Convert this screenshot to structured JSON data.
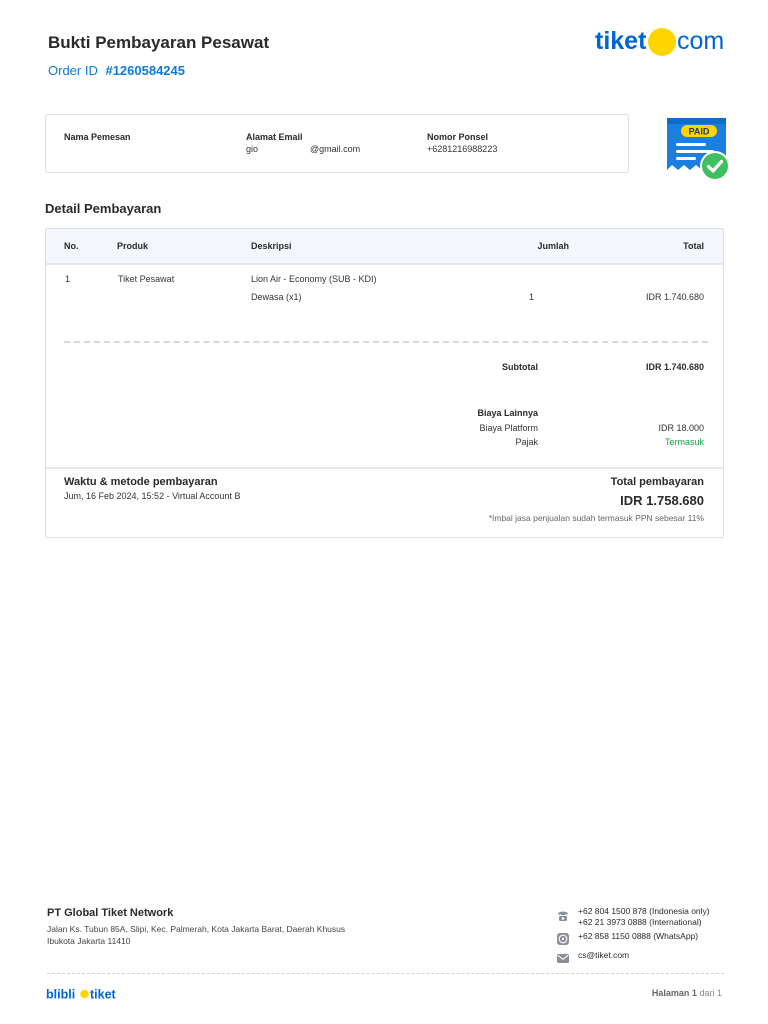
{
  "header": {
    "title": "Bukti Pembayaran Pesawat",
    "order_label": "Order ID",
    "order_id": "#1260584245",
    "logo_text": "tiket",
    "logo_suffix": "com",
    "logo_dot_color": "#FFD500",
    "brand_color": "#0064D2"
  },
  "customer": {
    "name_label": "Nama Pemesan",
    "name_value": "",
    "email_label": "Alamat Email",
    "email_user": "gio",
    "email_domain": "@gmail.com",
    "phone_label": "Nomor Ponsel",
    "phone_value": "+6281216988223"
  },
  "badge": {
    "text": "PAID",
    "icon": "paid-receipt-check-icon"
  },
  "details": {
    "title": "Detail Pembayaran",
    "columns": [
      "No.",
      "Produk",
      "Deskripsi",
      "Jumlah",
      "Total"
    ],
    "rows": [
      {
        "no": "1",
        "product": "Tiket Pesawat",
        "description": "Lion Air - Economy (SUB - KDI)",
        "sub_description": "Dewasa (x1)",
        "qty": "1",
        "total": "IDR 1.740.680"
      }
    ],
    "subtotal_label": "Subtotal",
    "subtotal_value": "IDR 1.740.680",
    "other_fees_label": "Biaya Lainnya",
    "fees": [
      {
        "label": "Biaya Platform",
        "value": "IDR 18.000"
      },
      {
        "label": "Pajak",
        "value": "Termasuk"
      }
    ]
  },
  "payment": {
    "title": "Waktu & metode pembayaran",
    "datetime_method": "Jum, 16 Feb 2024, 15:52 - Virtual Account B",
    "total_label": "Total pembayaran",
    "total_value": "IDR 1.758.680",
    "note": "*Imbal jasa penjualan sudah termasuk PPN sebesar 11%"
  },
  "footer": {
    "company": "PT Global Tiket Network",
    "address": "Jalan Ks. Tubun 85A, Slipi, Kec. Palmerah, Kota Jakarta Barat, Daerah Khusus Ibukota Jakarta 11410",
    "contacts": {
      "phone_id": "+62 804 1500 878 (Indonesia only)",
      "phone_intl": "+62 21 3973 0888 (International)",
      "whatsapp": "+62 858 1150 0888 (WhatsApp)",
      "email": "cs@tiket.com"
    },
    "footer_logo_left": "blibli",
    "footer_logo_right": "tiket",
    "page_label": "Halaman",
    "page_current": "1",
    "page_of": "dari",
    "page_total": "1"
  }
}
